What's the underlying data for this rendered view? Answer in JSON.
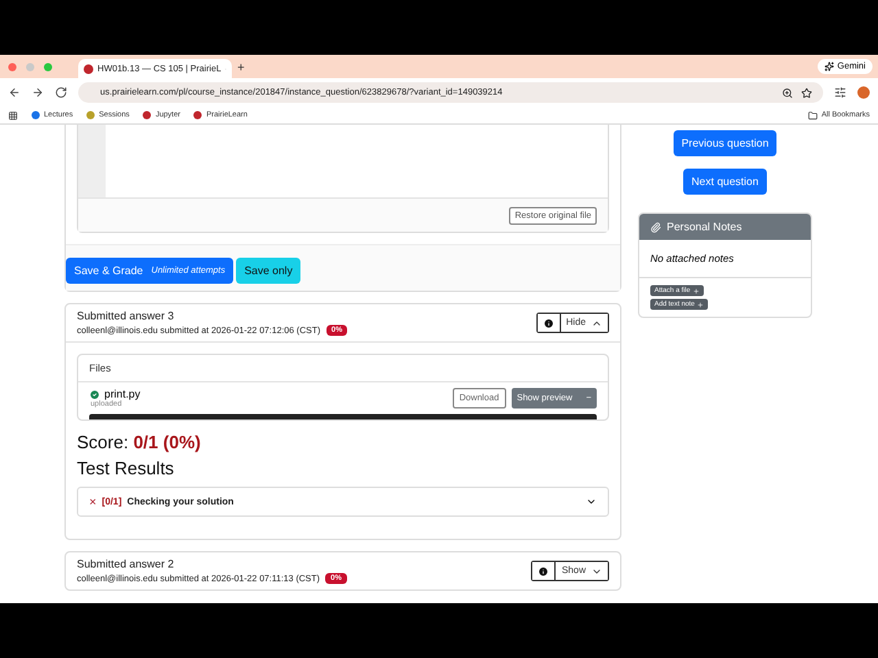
{
  "browser": {
    "tab": {
      "title": "HW01b.13 — CS 105 | PrairieL",
      "selected": true
    },
    "new_tab": "+",
    "gemini": "Gemini",
    "url": "us.prairielearn.com/pl/course_instance/201847/instance_question/623829678/?variant_id=149039214",
    "bookmarks": [
      "Lectures",
      "Sessions",
      "Jupyter",
      "PrairieLearn"
    ],
    "all_bookmarks": "All Bookmarks"
  },
  "editor": {
    "restore_button": "Restore original file"
  },
  "actions": {
    "grade_button": "Save & Grade",
    "grade_note": "Unlimited attempts",
    "save_button": "Save only"
  },
  "submissions": [
    {
      "title": "Submitted answer 3",
      "meta": "colleenl@illinois.edu submitted at 2026-01-22 07:12:06 (CST)",
      "badge": "0%",
      "toggle": "Hide",
      "expanded": true,
      "files": {
        "heading": "Files",
        "name": "print.py",
        "status": "uploaded",
        "download": "Download",
        "preview": "Show preview",
        "preview_symbol": "−"
      },
      "score_label": "Score:",
      "score": "0/1 (0%)",
      "results_heading": "Test Results",
      "tests": [
        {
          "mark": "×",
          "points": "[0/1]",
          "name": "Checking your solution",
          "passed": false
        }
      ]
    },
    {
      "title": "Submitted answer 2",
      "meta": "colleenl@illinois.edu submitted at 2026-01-22 07:11:13 (CST)",
      "badge": "0%",
      "toggle": "Show",
      "expanded": false
    }
  ],
  "sidebar": {
    "previous": "Previous question",
    "next": "Next question",
    "notes": {
      "title": "Personal Notes",
      "empty": "No attached notes",
      "buttons": [
        "Attach a file",
        "Add text note"
      ]
    }
  }
}
